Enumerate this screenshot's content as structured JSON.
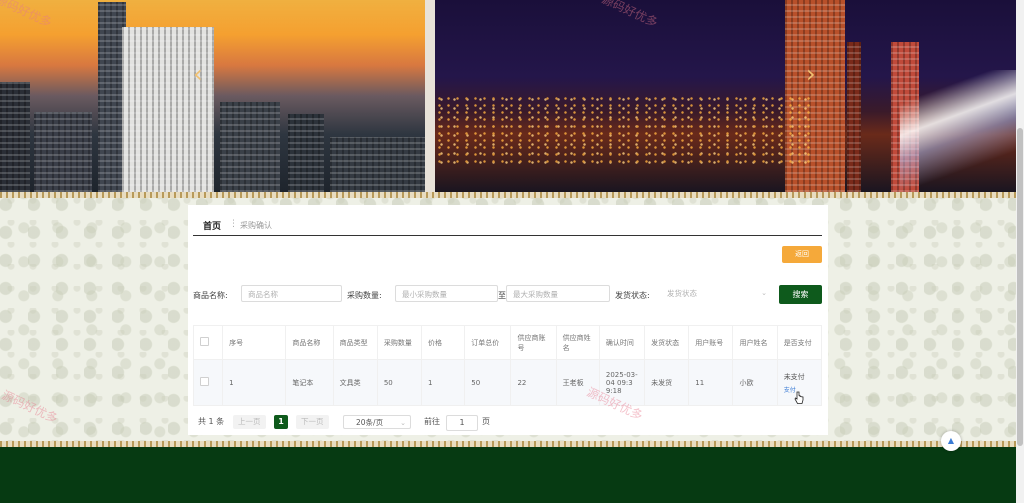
{
  "banner": {
    "prev_symbol": "‹",
    "next_symbol": "›"
  },
  "breadcrumb": {
    "home": "首页",
    "separator": "⋮",
    "current": "采购确认"
  },
  "actions": {
    "back_label": "返回",
    "search_label": "搜索"
  },
  "filters": {
    "product_name_label": "商品名称:",
    "product_name_placeholder": "商品名称",
    "quantity_label": "采购数量:",
    "quantity_min_placeholder": "最小采购数量",
    "quantity_to": "至",
    "quantity_max_placeholder": "最大采购数量",
    "ship_status_label": "发货状态:",
    "ship_status_placeholder": "发货状态"
  },
  "table": {
    "headers": [
      "序号",
      "商品名称",
      "商品类型",
      "采购数量",
      "价格",
      "订单总价",
      "供应商账号",
      "供应商姓名",
      "确认时间",
      "发货状态",
      "用户账号",
      "用户姓名",
      "是否支付"
    ],
    "rows": [
      {
        "cells": [
          "1",
          "笔记本",
          "文具类",
          "50",
          "1",
          "50",
          "22",
          "王老板",
          "2025-03-04 09:39:18",
          "未发货",
          "11",
          "小欧"
        ],
        "pay_status": "未支付",
        "pay_action": "支付"
      }
    ]
  },
  "pagination": {
    "total": "共 1 条",
    "prev": "上一页",
    "current_page": "1",
    "next": "下一页",
    "page_size": "20条/页",
    "goto_label": "前往",
    "goto_value": "1",
    "page_unit": "页"
  },
  "watermark": "源码好优多",
  "colors": {
    "primary": "#0e5a1c",
    "back_button": "#f5a93a",
    "footer": "#063a12",
    "link": "#3a7bd5"
  },
  "icons": {
    "scroll_top": "chevron-up-icon",
    "select_arrow": "chevron-down-icon",
    "cursor": "hand-pointer-icon"
  }
}
